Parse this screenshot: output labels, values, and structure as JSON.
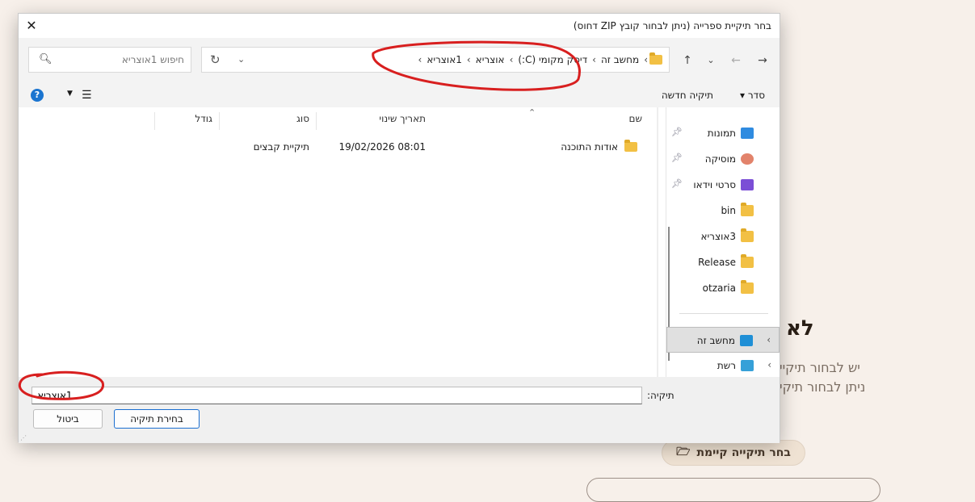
{
  "background": {
    "heading": "לא ו",
    "line1": "יש לבחור תיקיי",
    "line2": "ניתן לבחור תיקי",
    "choose_button": "בחר תיקייה קיימת"
  },
  "dialog": {
    "title": "בחר תיקיית ספרייה (ניתן לבחור קובץ ZIP דחוס)",
    "close_glyph": "✕",
    "breadcrumbs": [
      "מחשב זה",
      "דיסק מקומי (C:)",
      "אוצריא",
      "1אוצריא"
    ],
    "search_placeholder": "חיפוש 1אוצריא",
    "toolbar": {
      "organize": "סדר ▾",
      "new_folder": "תיקיה חדשה"
    },
    "columns": [
      "שם",
      "תאריך שינוי",
      "סוג",
      "גודל"
    ],
    "rows": [
      {
        "name": "אודות התוכנה",
        "modified": "19/02/2026 08:01",
        "type": "תיקיית קבצים",
        "size": ""
      }
    ],
    "nav": {
      "quick": [
        {
          "label": "תמונות",
          "icon": "pictures-icon",
          "pinned": true
        },
        {
          "label": "מוסיקה",
          "icon": "music-icon",
          "pinned": true
        },
        {
          "label": "סרטי וידאו",
          "icon": "video-icon",
          "pinned": true
        },
        {
          "label": "bin",
          "icon": "folder-icon",
          "pinned": false
        },
        {
          "label": "3אוצריא",
          "icon": "folder-icon",
          "pinned": false
        },
        {
          "label": "Release",
          "icon": "folder-icon",
          "pinned": false
        },
        {
          "label": "otzaria",
          "icon": "folder-icon",
          "pinned": false
        }
      ],
      "this_pc": "מחשב זה",
      "network": "רשת"
    },
    "footer": {
      "folder_label": "תיקיה:",
      "folder_value": "1אוצריא",
      "select_button": "בחירת תיקיה",
      "cancel_button": "ביטול"
    }
  }
}
